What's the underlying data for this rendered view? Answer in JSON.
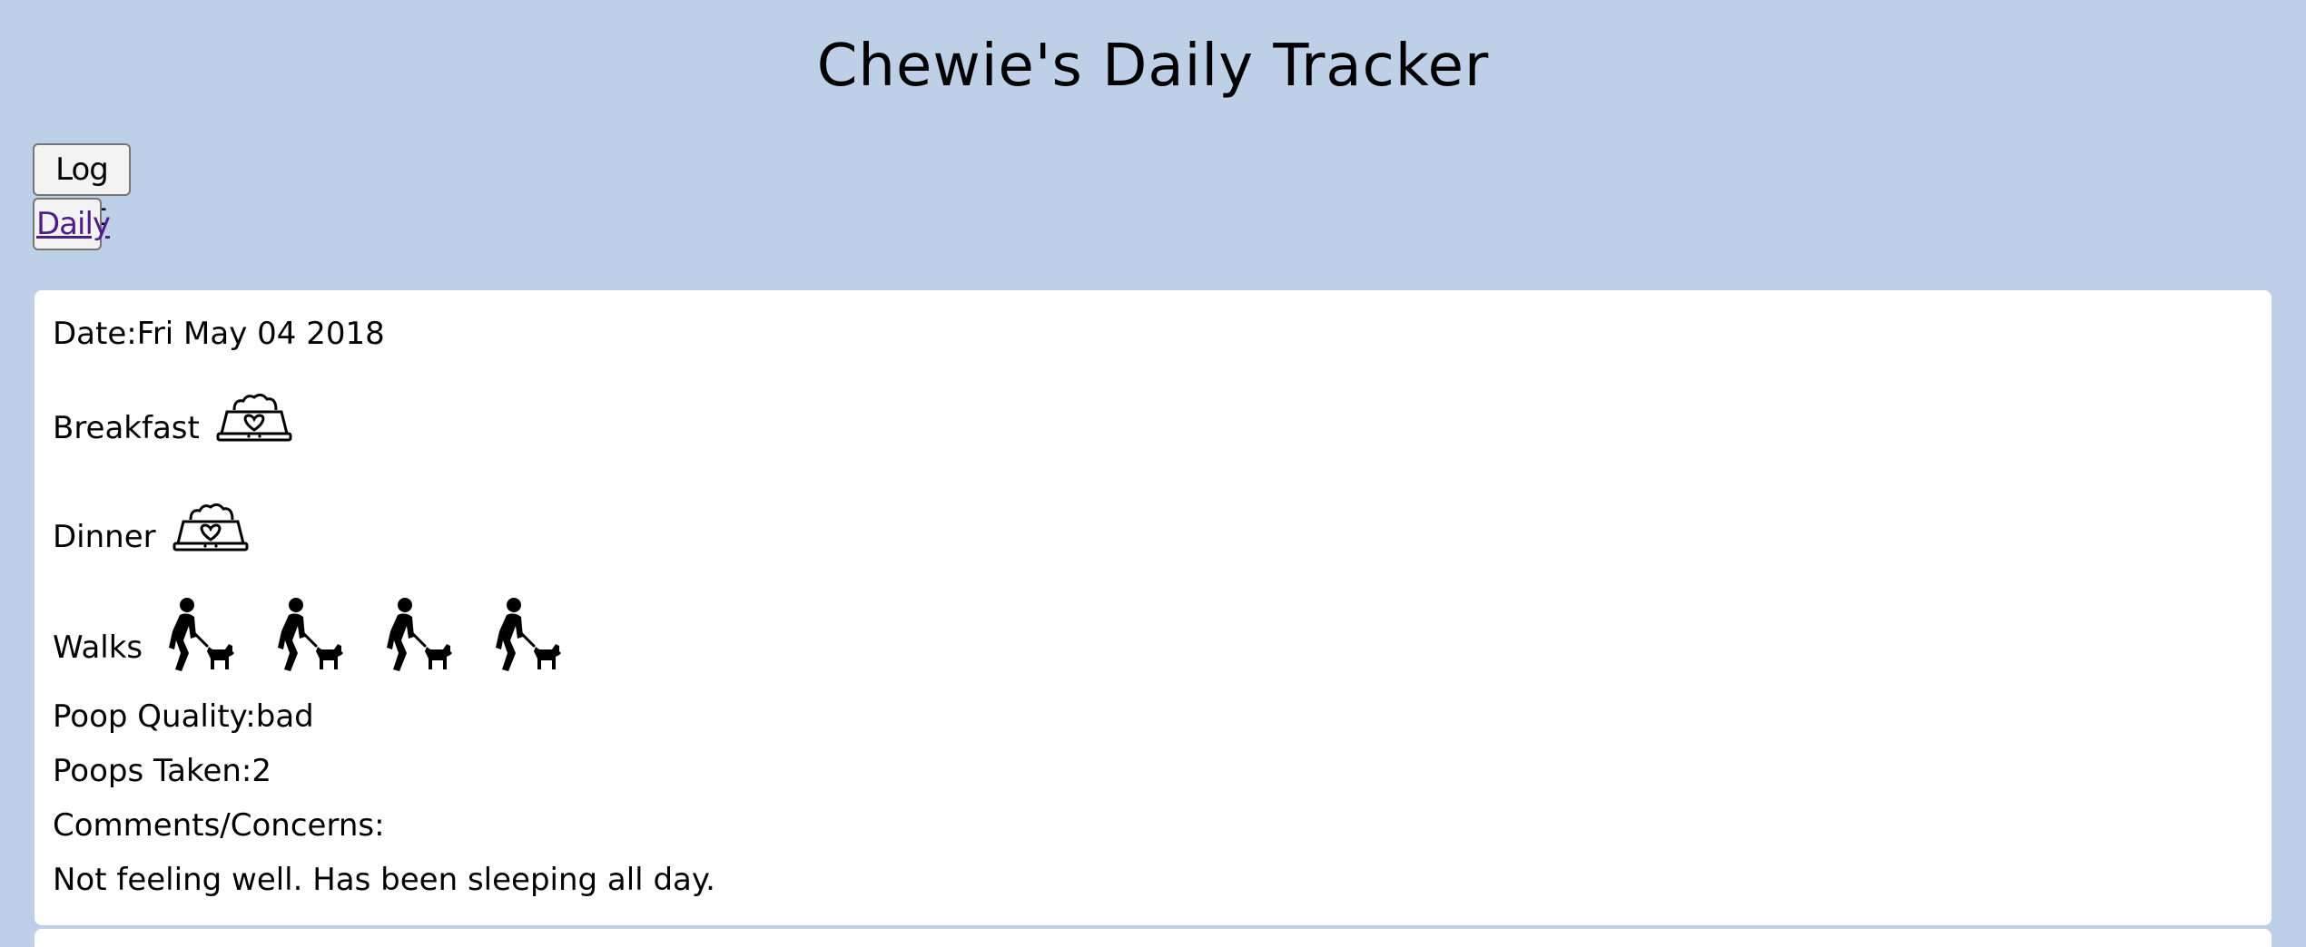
{
  "header": {
    "title": "Chewie's Daily Tracker"
  },
  "nav": {
    "logout_label": "Log out",
    "daily_label": "Daily"
  },
  "entry": {
    "date_label": "Date:",
    "date_value": "Fri May 04 2018",
    "breakfast_label": "Breakfast",
    "breakfast_icon": "dog-bowl-icon",
    "dinner_label": "Dinner",
    "dinner_icon": "dog-bowl-icon",
    "walks_label": "Walks",
    "walks_count": 4,
    "walk_icon": "dog-walker-icon",
    "poop_quality_label": "Poop Quality:",
    "poop_quality_value": "bad",
    "poops_taken_label": "Poops Taken:",
    "poops_taken_value": "2",
    "comments_label": "Comments/Concerns:",
    "comments_value": "Not feeling well. Has been sleeping all day."
  },
  "colors": {
    "background": "#bdd0e8",
    "card": "#ffffff",
    "link": "#4b1f86"
  }
}
